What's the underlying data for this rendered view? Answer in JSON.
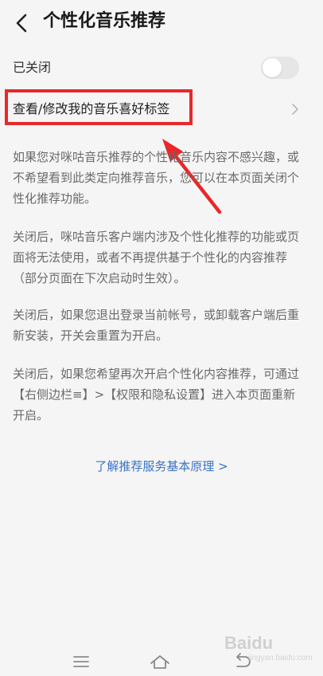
{
  "header": {
    "title": "个性化音乐推荐",
    "back_icon": "chevron-left-icon"
  },
  "toggle_row": {
    "label": "已关闭",
    "enabled": false
  },
  "preference_row": {
    "label": "查看/修改我的音乐喜好标签",
    "chevron_icon": "chevron-right-icon"
  },
  "annotation": {
    "box_color": "#e8282a",
    "arrow_color": "#e8282a"
  },
  "description": {
    "paragraphs": [
      "如果您对咪咕音乐推荐的个性化音乐内容不感兴趣，或不希望看到此类定向推荐音乐，您可以在本页面关闭个性化推荐功能。",
      "关闭后，咪咕音乐客户端内涉及个性化推荐的功能或页面将无法使用，或者不再提供基于个性化的内容推荐（部分页面在下次启动时生效）。",
      "关闭后，如果您退出登录当前帐号，或卸载客户端后重新安装，开关会重置为开启。",
      "关闭后，如果您希望再次开启个性化内容推荐，可通过【右侧边栏≡】>【权限和隐私设置】进入本页面重新开启。"
    ]
  },
  "link": {
    "label": "了解推荐服务基本原理 >",
    "color": "#3a73c4"
  },
  "navbar": {
    "items": [
      {
        "icon": "menu-icon"
      },
      {
        "icon": "home-icon"
      },
      {
        "icon": "back-icon"
      }
    ]
  },
  "watermark": {
    "brand": "Baidu",
    "subtitle": "jingyan.baidu.com"
  }
}
